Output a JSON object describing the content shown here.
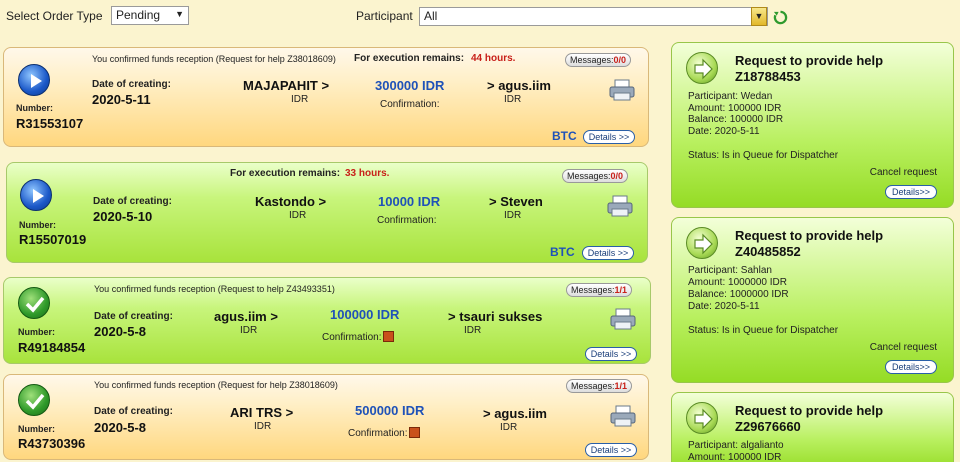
{
  "toolbar": {
    "order_type_label": "Select Order Type",
    "order_type_value": "Pending",
    "participant_label": "Participant",
    "participant_value": "All"
  },
  "orders": [
    {
      "status_icon": "play-icon",
      "note": "You confirmed funds reception (Request for help Z38018609)",
      "remains_label": "For execution remains:",
      "remains_value": "44 hours.",
      "messages_label": "Messages:",
      "messages_value": "0/0",
      "number_label": "Number:",
      "number": "R31553107",
      "date_label": "Date of creating:",
      "date": "2020-5-11",
      "from": "MAJAPAHIT >",
      "from_sub": "IDR",
      "amount": "300000 IDR",
      "confirmation_label": "Confirmation:",
      "to": "> agus.iim",
      "to_sub": "IDR",
      "currency": "BTC",
      "details_label": "Details >>"
    },
    {
      "status_icon": "play-icon",
      "note": "",
      "remains_label": "For execution remains:",
      "remains_value": "33 hours.",
      "messages_label": "Messages:",
      "messages_value": "0/0",
      "number_label": "Number:",
      "number": "R15507019",
      "date_label": "Date of creating:",
      "date": "2020-5-10",
      "from": "Kastondo >",
      "from_sub": "IDR",
      "amount": "10000 IDR",
      "confirmation_label": "Confirmation:",
      "to": "> Steven",
      "to_sub": "IDR",
      "currency": "BTC",
      "details_label": "Details >>"
    },
    {
      "status_icon": "check-icon",
      "note": "You confirmed funds reception (Request to help Z43493351)",
      "messages_label": "Messages:",
      "messages_value": "1/1",
      "number_label": "Number:",
      "number": "R49184854",
      "date_label": "Date of creating:",
      "date": "2020-5-8",
      "from": "agus.iim >",
      "from_sub": "IDR",
      "amount": "100000 IDR",
      "confirmation_label": "Confirmation:",
      "to": "> tsauri sukses",
      "to_sub": "IDR",
      "details_label": "Details >>"
    },
    {
      "status_icon": "check-icon",
      "note": "You confirmed funds reception (Request for help Z38018609)",
      "messages_label": "Messages:",
      "messages_value": "1/1",
      "number_label": "Number:",
      "number": "R43730396",
      "date_label": "Date of creating:",
      "date": "2020-5-8",
      "from": "ARI TRS >",
      "from_sub": "IDR",
      "amount": "500000 IDR",
      "confirmation_label": "Confirmation:",
      "to": "> agus.iim",
      "to_sub": "IDR",
      "details_label": "Details >>"
    }
  ],
  "requests": [
    {
      "title": "Request to provide help",
      "id": "Z18788453",
      "participant": "Participant: Wedan",
      "amount": "Amount: 100000 IDR",
      "balance": "Balance: 100000 IDR",
      "date": "Date: 2020-5-11",
      "status": "Status: Is in Queue for Dispatcher",
      "cancel": "Cancel request",
      "details": "Details>>"
    },
    {
      "title": "Request to provide help",
      "id": "Z40485852",
      "participant": "Participant: Sahlan",
      "amount": "Amount: 1000000 IDR",
      "balance": "Balance: 1000000 IDR",
      "date": "Date: 2020-5-11",
      "status": "Status: Is in Queue for Dispatcher",
      "cancel": "Cancel request",
      "details": "Details>>"
    },
    {
      "title": "Request to provide help",
      "id": "Z29676660",
      "participant": "Participant: algalianto",
      "amount": "Amount: 100000 IDR"
    }
  ],
  "colors": {
    "amount_blue": "#1f52b8",
    "remains_red": "#c8201a",
    "orange_card": "#ffd77e",
    "green_card": "#a8e33c"
  }
}
